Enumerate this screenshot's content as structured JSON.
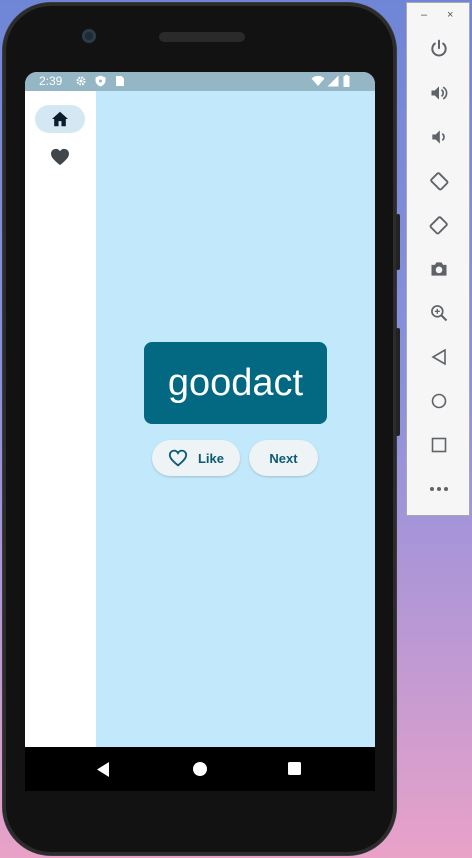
{
  "status_bar": {
    "time": "2:39",
    "icons": [
      "settings-icon",
      "shield-icon",
      "sim-card-icon",
      "wifi-icon",
      "signal-icon",
      "battery-icon"
    ]
  },
  "nav_rail": {
    "items": [
      {
        "icon": "home-icon",
        "selected": true
      },
      {
        "icon": "heart-filled-icon",
        "selected": false
      }
    ]
  },
  "main": {
    "word": "goodact",
    "like_label": "Like",
    "next_label": "Next"
  },
  "android_nav": [
    "back-icon",
    "home-circle-icon",
    "overview-icon"
  ],
  "emulator_panel": {
    "window_controls": [
      "–",
      "×"
    ],
    "tools": [
      "power-icon",
      "volume-up-icon",
      "volume-down-icon",
      "rotate-left-icon",
      "rotate-right-icon",
      "camera-icon",
      "zoom-icon",
      "back-icon",
      "home-icon",
      "overview-icon",
      "more-icon"
    ]
  },
  "colors": {
    "background": "#c2e9fb",
    "card": "#036882",
    "accent": "#0c5b74",
    "status_bar": "#95b6c4"
  }
}
